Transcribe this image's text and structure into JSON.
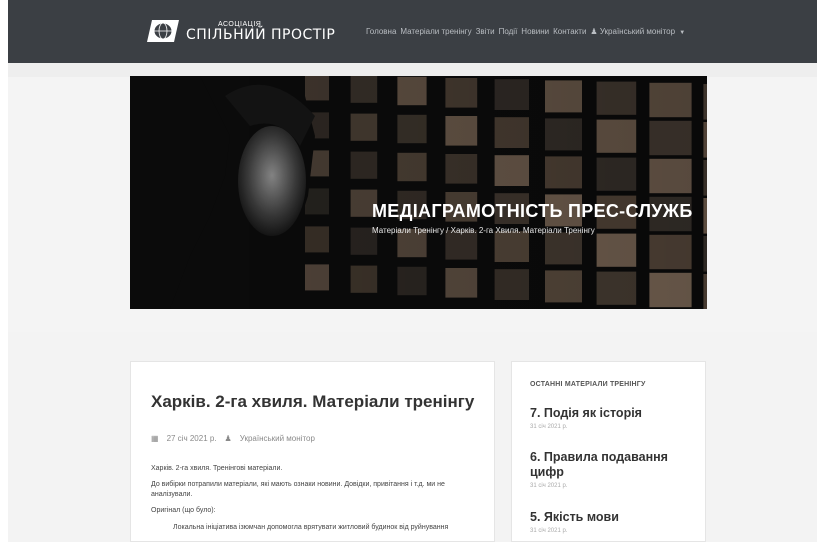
{
  "brand": {
    "top": "АСОЦІАЦІЯ",
    "main": "СПІЛЬНИЙ ПРОСТІР"
  },
  "nav": {
    "items": [
      "Головна",
      "Матеріали тренінгу",
      "Звіти",
      "Події",
      "Новини",
      "Контакти"
    ],
    "user": "Український монітор"
  },
  "hero": {
    "title": "МЕДІАГРАМОТНІСТЬ ПРЕС-СЛУЖБ",
    "breadcrumb": "Матеріали Тренінгу / Харків. 2-га Хвиля. Матеріали Тренінгу"
  },
  "article": {
    "title": "Харків. 2-га хвиля. Матеріали тренінгу",
    "date": "27 січ 2021 р.",
    "author": "Український монітор",
    "paragraphs": [
      "Харків. 2-га хвиля. Тренінгові матеріали.",
      "До вибірки потрапили матеріали, які мають ознаки новини. Довідки, привітання і т.д. ми не аналізували.",
      "Оригінал (що було):",
      "Локальна ініціатива ізюмчан допомогла врятувати житловий будинок від руйнування"
    ]
  },
  "sidebar": {
    "heading": "ОСТАННІ МАТЕРІАЛИ ТРЕНІНГУ",
    "posts": [
      {
        "title": "7. Подія як історія",
        "date": "31 січ 2021 р."
      },
      {
        "title": "6. Правила подавання цифр",
        "date": "31 січ 2021 р."
      },
      {
        "title": "5. Якість мови",
        "date": "31 січ 2021 р."
      }
    ]
  },
  "colors": {
    "navbar": "#3b3f44",
    "nav_text": "#b9bdc2",
    "hero_bg": "#0b0b0b",
    "panel_bg": "#f3f3f3"
  }
}
